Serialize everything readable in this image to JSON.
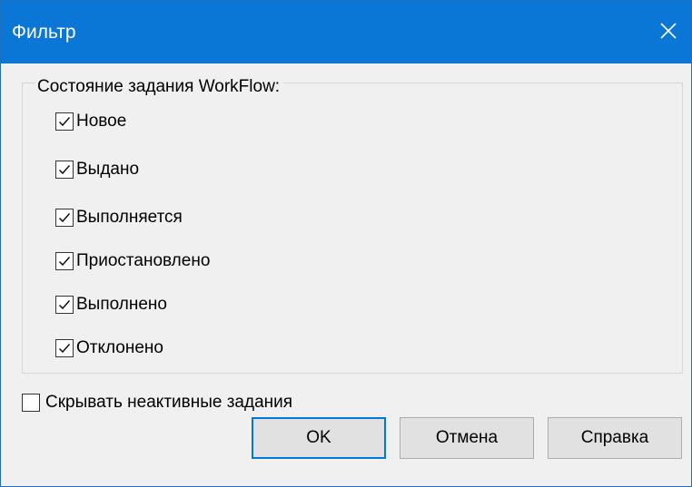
{
  "window": {
    "title": "Фильтр",
    "close_icon": "close-icon"
  },
  "status_group": {
    "legend": "Состояние задания WorkFlow:",
    "items": [
      {
        "label": "Новое",
        "checked": true
      },
      {
        "label": "Выдано",
        "checked": true
      },
      {
        "label": "Выполняется",
        "checked": true
      },
      {
        "label": "Приостановлено",
        "checked": true
      },
      {
        "label": "Выполнено",
        "checked": true
      },
      {
        "label": "Отклонено",
        "checked": true
      }
    ]
  },
  "hide_inactive": {
    "label": "Скрывать неактивные задания",
    "checked": false
  },
  "buttons": {
    "ok": "OK",
    "cancel": "Отмена",
    "help": "Справка"
  },
  "colors": {
    "titlebar": "#0a76d6",
    "dialog_bg": "#f0f0f0",
    "button_bg": "#e1e1e1",
    "default_button_border": "#0078d7"
  }
}
